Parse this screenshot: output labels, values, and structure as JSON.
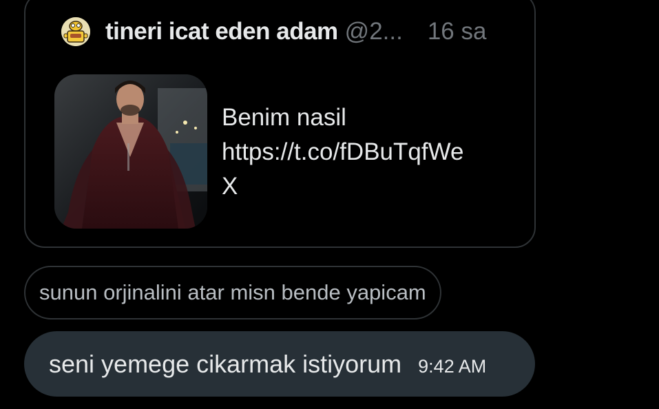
{
  "quoted_tweet": {
    "author_name": "tineri icat eden adam",
    "author_handle": "@2...",
    "time_ago": "16 sa",
    "text_line1": "Benim nasil",
    "text_line2": "https://t.co/fDBuTqfWe",
    "text_line3": "X",
    "avatar_icon": "yellow-cartoon-character-icon",
    "media_icon": "photo-thumbnail"
  },
  "reply": {
    "text": "sunun orjinalini atar misn bende yapicam"
  },
  "message": {
    "text": "seni yemege cikarmak istiyorum",
    "time": "9:42 AM"
  },
  "colors": {
    "background": "#000000",
    "card_border": "#2f3336",
    "primary_text": "#e7e9ea",
    "secondary_text": "#71767b",
    "sent_bubble": "#273037"
  }
}
